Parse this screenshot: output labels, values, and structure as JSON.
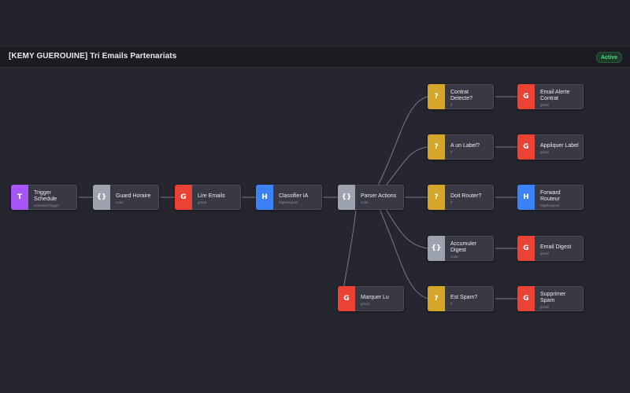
{
  "header": {
    "title": "[KEMY GUEROUINE] Tri Emails Partenariats",
    "status_badge": "Active"
  },
  "colors": {
    "trigger": "#a855f7",
    "code": "#9ca3af",
    "gmail": "#ea4335",
    "http": "#3b82f6",
    "if": "#d4a62a",
    "edge": "#7a7b86",
    "active": "#4ade80"
  },
  "nodes": [
    {
      "id": "trigger",
      "label": "Trigger Schedule",
      "type": "scheduleTrigger",
      "icon": "T",
      "kind": "trigger"
    },
    {
      "id": "guard",
      "label": "Guard Horaire",
      "type": "code",
      "icon": "{}",
      "kind": "code"
    },
    {
      "id": "lire",
      "label": "Lire Emails",
      "type": "gmail",
      "icon": "G",
      "kind": "gmail"
    },
    {
      "id": "classifier",
      "label": "Classifier IA",
      "type": "httpRequest",
      "icon": "H",
      "kind": "http"
    },
    {
      "id": "parser",
      "label": "Parser Actions",
      "type": "code",
      "icon": "{}",
      "kind": "code"
    },
    {
      "id": "marquer",
      "label": "Marquer Lu",
      "type": "gmail",
      "icon": "G",
      "kind": "gmail"
    },
    {
      "id": "contrat",
      "label": "Contrat Detecte?",
      "type": "if",
      "icon": "?",
      "kind": "if"
    },
    {
      "id": "label",
      "label": "A un Label?",
      "type": "if",
      "icon": "?",
      "kind": "if"
    },
    {
      "id": "router",
      "label": "Doit Router?",
      "type": "if",
      "icon": "?",
      "kind": "if"
    },
    {
      "id": "accumuler",
      "label": "Accumuler Digest",
      "type": "code",
      "icon": "{}",
      "kind": "code"
    },
    {
      "id": "spam",
      "label": "Est Spam?",
      "type": "if",
      "icon": "?",
      "kind": "if"
    },
    {
      "id": "alerte",
      "label": "Email Alerte Contrat",
      "type": "gmail",
      "icon": "G",
      "kind": "gmail"
    },
    {
      "id": "appliquer",
      "label": "Appliquer Label",
      "type": "gmail",
      "icon": "G",
      "kind": "gmail"
    },
    {
      "id": "forward",
      "label": "Forward Routeur",
      "type": "httpRequest",
      "icon": "H",
      "kind": "http"
    },
    {
      "id": "digest",
      "label": "Email Digest",
      "type": "gmail",
      "icon": "G",
      "kind": "gmail"
    },
    {
      "id": "supprimer",
      "label": "Supprimer Spam",
      "type": "gmail",
      "icon": "G",
      "kind": "gmail"
    }
  ]
}
